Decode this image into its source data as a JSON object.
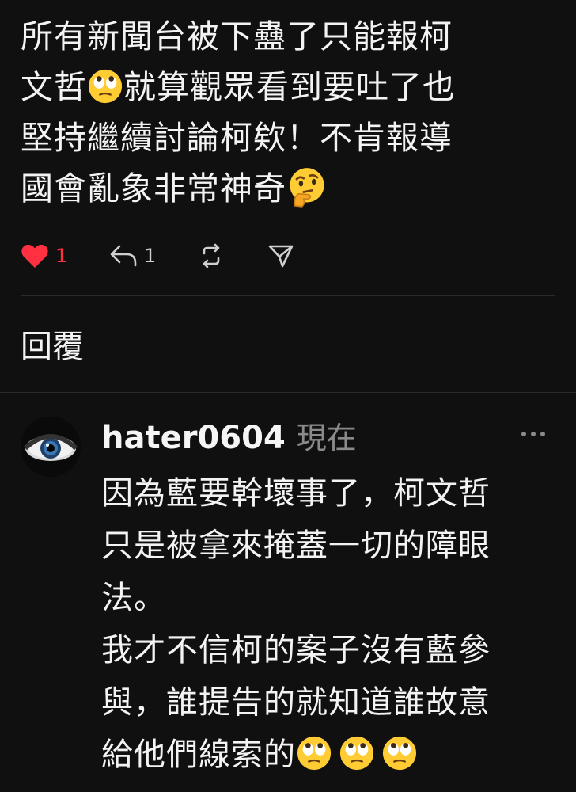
{
  "post": {
    "lines": [
      "所有新聞台被下蠱了只能報柯",
      "文哲",
      "就算觀眾看到要吐了也",
      "堅持繼續討論柯欸！不肯報導",
      "國會亂象非常神奇"
    ],
    "emoji_1": "face-with-rolling-eyes-icon",
    "emoji_2": "thinking-face-icon"
  },
  "actions": {
    "like_count": "1",
    "reply_count": "1",
    "like_color": "#ff3040"
  },
  "replies_heading": "回覆",
  "reply": {
    "username": "hater0604",
    "timestamp": "現在",
    "lines": [
      "因為藍要幹壞事了，柯文哲",
      "只是被拿來掩蓋一切的障眼",
      "法。",
      "我才不信柯的案子沒有藍參",
      "與，誰提告的就知道誰故意",
      "給他們線索的"
    ],
    "trailing_emojis": [
      "face-with-rolling-eyes-icon",
      "face-with-rolling-eyes-icon",
      "face-with-rolling-eyes-icon"
    ]
  }
}
